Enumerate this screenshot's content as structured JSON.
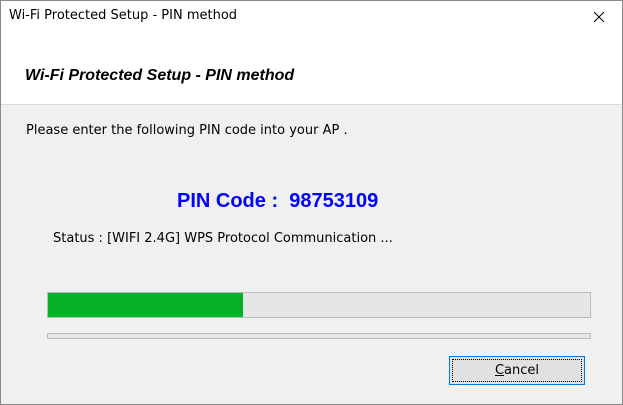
{
  "window": {
    "title": "Wi-Fi Protected Setup - PIN method",
    "close_icon": "close-icon"
  },
  "header": {
    "heading": "Wi-Fi Protected Setup - PIN method"
  },
  "main": {
    "instruction": "Please enter the following PIN code into your AP .",
    "pin_label": "PIN Code :  98753109",
    "status": "Status : [WIFI 2.4G] WPS Protocol Communication ...",
    "progress_fraction": 0.36,
    "secondary_progress_fraction": 0,
    "colors": {
      "pin": "#0000ff",
      "progress_fill": "#06b025"
    }
  },
  "buttons": {
    "cancel_mnemonic": "C",
    "cancel_rest": "ancel"
  }
}
